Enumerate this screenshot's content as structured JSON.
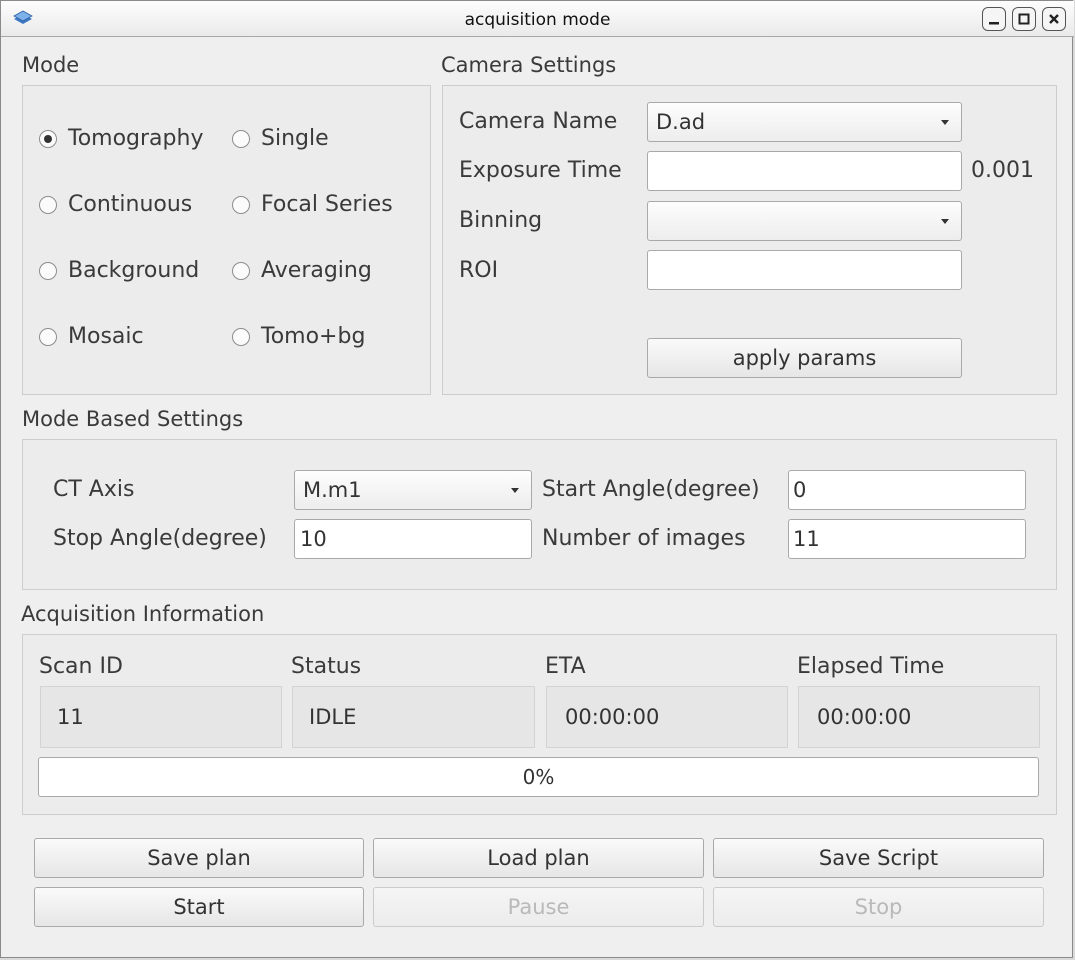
{
  "window": {
    "title": "acquisition mode"
  },
  "mode": {
    "label": "Mode",
    "options": [
      {
        "label": "Tomography",
        "selected": true
      },
      {
        "label": "Single",
        "selected": false
      },
      {
        "label": "Continuous",
        "selected": false
      },
      {
        "label": "Focal Series",
        "selected": false
      },
      {
        "label": "Background",
        "selected": false
      },
      {
        "label": "Averaging",
        "selected": false
      },
      {
        "label": "Mosaic",
        "selected": false
      },
      {
        "label": "Tomo+bg",
        "selected": false
      }
    ]
  },
  "camera": {
    "label": "Camera Settings",
    "camera_name_label": "Camera Name",
    "camera_name_value": "D.ad",
    "exposure_label": "Exposure Time",
    "exposure_value": "",
    "exposure_readout": "0.001",
    "binning_label": "Binning",
    "binning_value": "",
    "roi_label": "ROI",
    "roi_value": "",
    "apply_label": "apply params"
  },
  "mode_settings": {
    "label": "Mode Based Settings",
    "ct_axis_label": "CT Axis",
    "ct_axis_value": "M.m1",
    "start_angle_label": "Start Angle(degree)",
    "start_angle_value": "0",
    "stop_angle_label": "Stop Angle(degree)",
    "stop_angle_value": "10",
    "num_images_label": "Number of images",
    "num_images_value": "11"
  },
  "acquisition": {
    "label": "Acquisition Information",
    "scan_id_label": "Scan ID",
    "scan_id_value": "11",
    "status_label": "Status",
    "status_value": "IDLE",
    "eta_label": "ETA",
    "eta_value": "00:00:00",
    "elapsed_label": "Elapsed Time",
    "elapsed_value": "00:00:00",
    "progress": 0,
    "progress_text": "0%"
  },
  "buttons": {
    "save_plan": "Save plan",
    "load_plan": "Load plan",
    "save_script": "Save Script",
    "start": "Start",
    "pause": "Pause",
    "stop": "Stop"
  },
  "icons": {
    "app": "app-logo-icon",
    "minimize": "minimize-icon",
    "maximize": "maximize-icon",
    "close": "close-icon",
    "dropdown": "chevron-down-icon"
  },
  "colors": {
    "progress_fill": "#7fa7d8",
    "window_bg": "#efefef"
  }
}
